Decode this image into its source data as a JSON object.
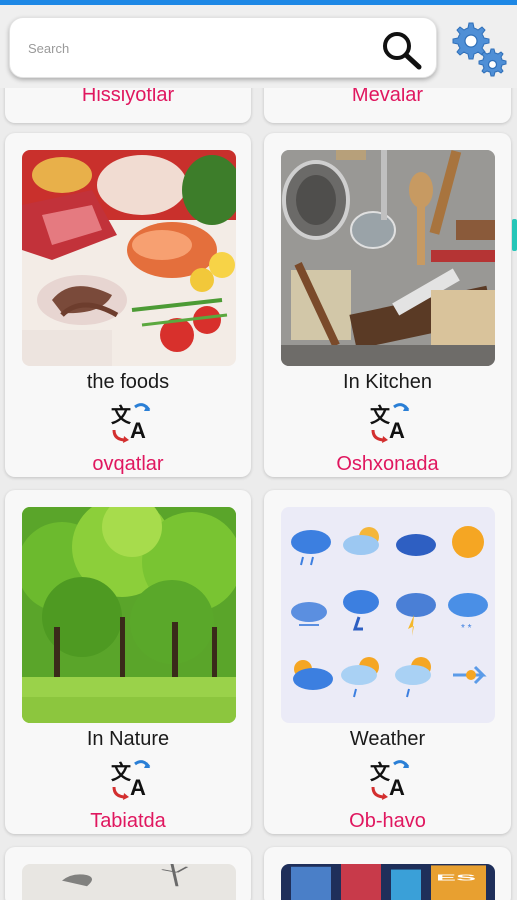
{
  "search": {
    "placeholder": "Search"
  },
  "categories": [
    {
      "uz": "Hissiyotlar"
    },
    {
      "uz": "Mevalar"
    },
    {
      "en": "the foods",
      "uz": "ovqatlar",
      "image": "food-photo"
    },
    {
      "en": "In Kitchen",
      "uz": "Oshxonada",
      "image": "kitchen-photo"
    },
    {
      "en": "In Nature",
      "uz": "Tabiatda",
      "image": "nature-photo"
    },
    {
      "en": "Weather",
      "uz": "Ob-havo",
      "image": "weather-icons"
    }
  ],
  "icons": {
    "search": "search-icon",
    "settings": "gear-icon",
    "translate": "translate-icon"
  },
  "colors": {
    "accent": "#e0175f",
    "statusbar": "#1e88e5",
    "background": "#ececec"
  }
}
